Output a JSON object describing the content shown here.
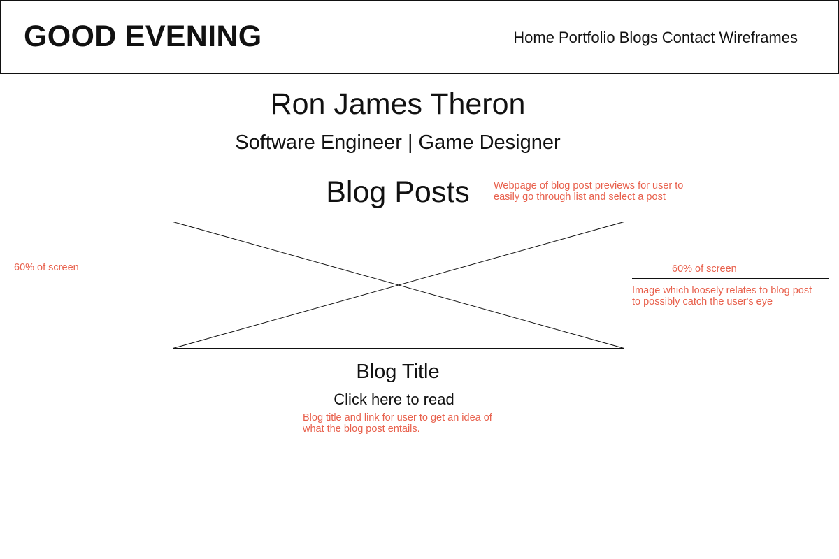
{
  "header": {
    "title": "GOOD EVENING",
    "nav": [
      "Home",
      "Portfolio",
      "Blogs",
      "Contact",
      "Wireframes"
    ]
  },
  "profile": {
    "name": "Ron James Theron",
    "tagline": "Software Engineer | Game Designer"
  },
  "section": {
    "title": "Blog Posts"
  },
  "annotations": {
    "blog_posts_note": [
      "Webpage of blog post previews for user to",
      "easily go through list and select a post"
    ],
    "left_width_note": "60% of screen",
    "right_width_note": "60% of screen",
    "image_note": [
      "Image which loosely relates to blog post",
      "to possibly catch the user's eye"
    ],
    "title_note": [
      "Blog title and link for user to get an idea of",
      "what the blog post entails."
    ]
  },
  "post": {
    "title": "Blog Title",
    "link_text": "Click here to read"
  },
  "colors": {
    "annotation": "#e8604c",
    "text": "#111111",
    "lines": "#111111"
  }
}
